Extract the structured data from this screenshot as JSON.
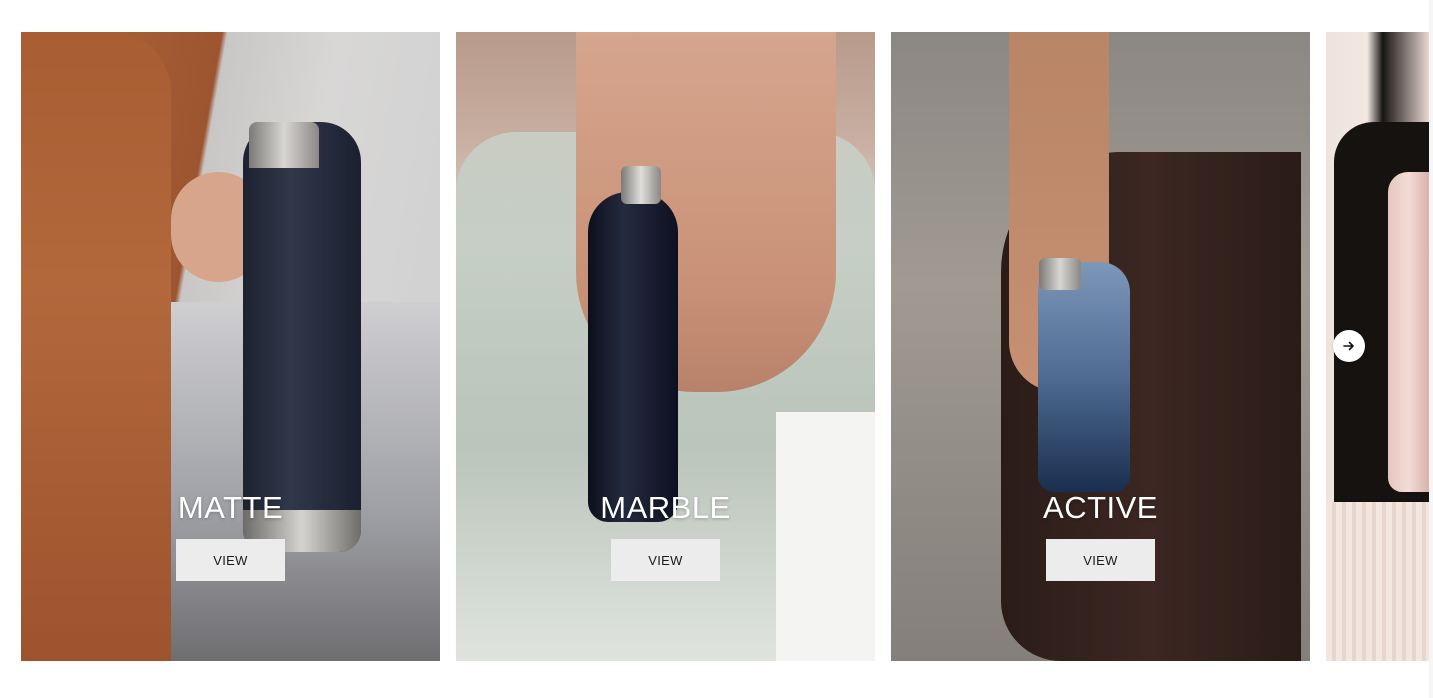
{
  "carousel": {
    "cards": [
      {
        "title": "MATTE",
        "button_label": "VIEW"
      },
      {
        "title": "MARBLE",
        "button_label": "VIEW"
      },
      {
        "title": "ACTIVE",
        "button_label": "VIEW"
      }
    ],
    "next_icon": "arrow-right-icon"
  }
}
